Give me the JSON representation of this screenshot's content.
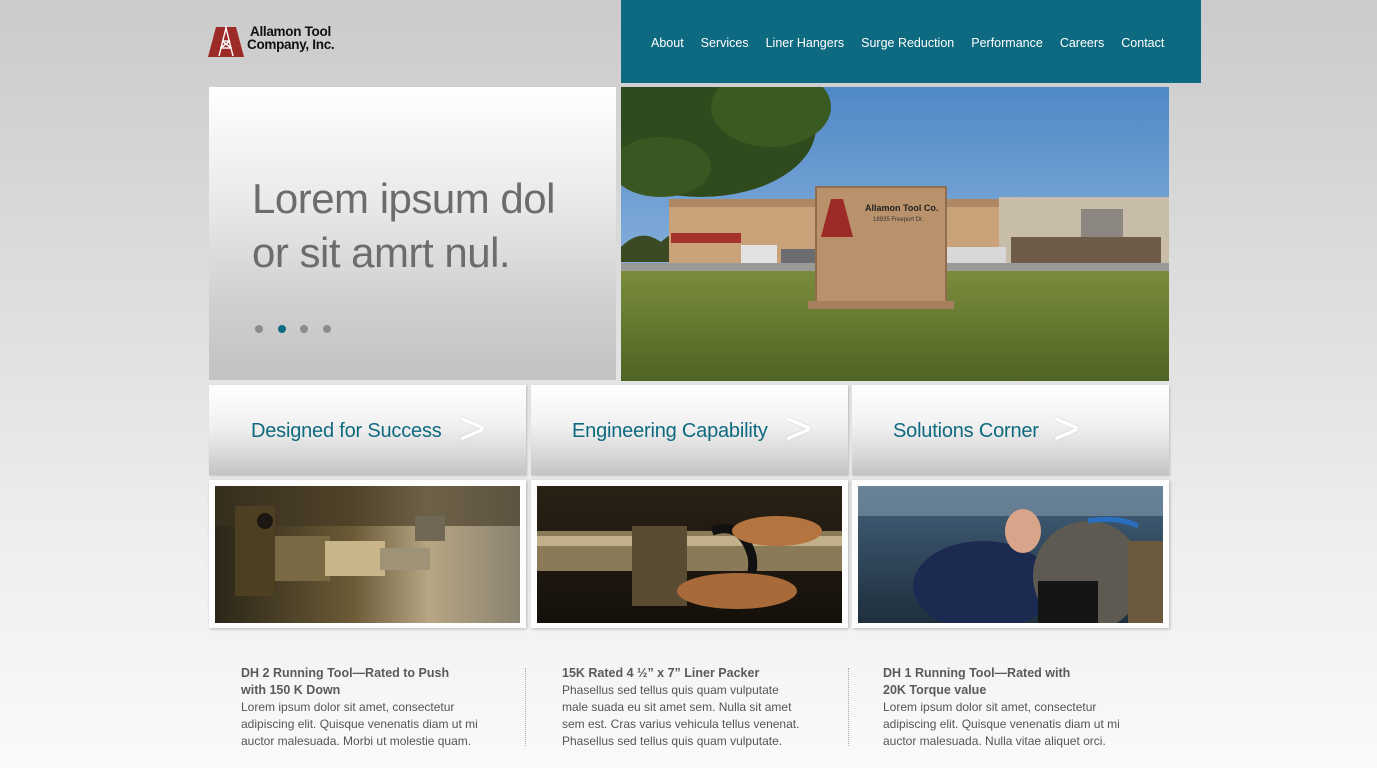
{
  "logo": {
    "line1": "Allamon Tool",
    "line2": "Company, Inc.",
    "brand_color": "#9c2a27"
  },
  "nav": {
    "background": "#0e6a80",
    "items": [
      "About",
      "Services",
      "Liner Hangers",
      "Surge Reduction",
      "Performance",
      "Careers",
      "Contact"
    ]
  },
  "hero": {
    "title": "Lorem ipsum dol or sit amrt nul.",
    "slides": 4,
    "active_slide": 2,
    "photo_sign": {
      "line1": "Allamon Tool Co.",
      "line2": "18935 Freeport Dr."
    }
  },
  "cards": [
    {
      "title": "Designed for Success",
      "arrow": ">",
      "image": "lathe-chuck-photo"
    },
    {
      "title": "Engineering Capability",
      "arrow": ">",
      "image": "caliper-measurement-photo"
    },
    {
      "title": "Solutions Corner",
      "arrow": ">",
      "image": "machinist-at-lathe-photo"
    }
  ],
  "columns": [
    {
      "heading_line1": "DH 2 Running Tool—Rated to Push",
      "heading_line2": "with 150 K Down",
      "body": [
        "Lorem ipsum dolor sit amet, consectetur",
        "adipiscing elit. Quisque venenatis diam ut mi",
        "auctor malesuada. Morbi ut molestie quam."
      ]
    },
    {
      "heading_line1": "15K Rated 4 ½” x 7” Liner Packer",
      "heading_line2": "",
      "body": [
        "Phasellus sed tellus quis quam vulputate",
        "male suada eu sit amet sem. Nulla sit amet",
        "sem est. Cras varius vehicula tellus venenat.",
        "Phasellus sed tellus quis quam vulputate."
      ]
    },
    {
      "heading_line1": "DH 1  Running Tool—Rated with",
      "heading_line2": "20K Torque value",
      "body": [
        "Lorem ipsum dolor sit amet, consectetur",
        "adipiscing elit. Quisque venenatis diam ut mi",
        "auctor malesuada. Nulla vitae aliquet orci."
      ]
    }
  ]
}
